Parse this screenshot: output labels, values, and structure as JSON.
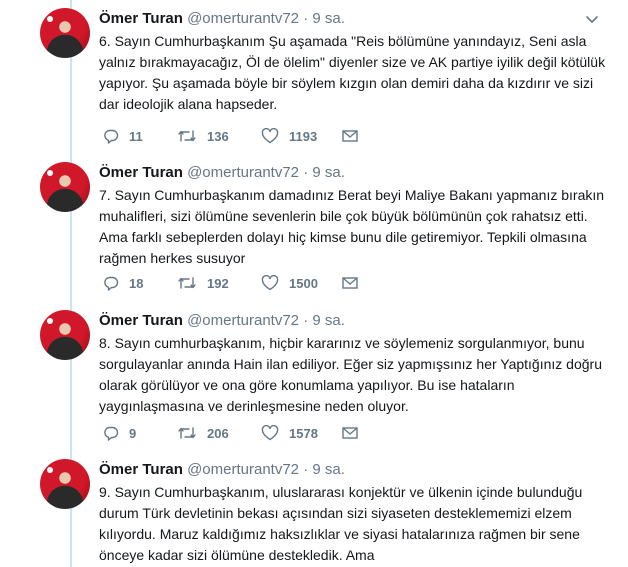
{
  "tweets": [
    {
      "name": "Ömer Turan",
      "handle": "@omerturantv72",
      "dot": "·",
      "time": "9 sa.",
      "text": "6. Sayın Cumhurbaşkanım Şu aşamada \"Reis bölümüne yanındayız, Seni asla yalnız bırakmayacağız, Öl de ölelim\" diyenler size ve AK partiye iyilik değil kötülük yapıyor. Şu aşamada böyle bir söylem kızgın olan demiri daha da kızdırır ve sizi dar ideolojik alana hapseder.",
      "replies": "11",
      "retweets": "136",
      "likes": "1193"
    },
    {
      "name": "Ömer Turan",
      "handle": "@omerturantv72",
      "dot": "·",
      "time": "9 sa.",
      "text": "7. Sayın Cumhurbaşkanım damadınız Berat beyi Maliye Bakanı yapmanız  bırakın muhalifleri, sizi ölümüne sevenlerin bile  çok büyük bölümünün çok rahatsız etti. Ama farklı sebeplerden dolayı hiç kimse bunu dile getiremiyor. Tepkili olmasına rağmen herkes susuyor",
      "replies": "18",
      "retweets": "192",
      "likes": "1500"
    },
    {
      "name": "Ömer Turan",
      "handle": "@omerturantv72",
      "dot": "·",
      "time": "9 sa.",
      "text": "8. Sayın cumhurbaşkanım, hiçbir kararınız ve söylemeniz sorgulanmıyor, bunu sorgulayanlar anında Hain ilan ediliyor. Eğer siz yapmışsınız her Yaptığınız doğru olarak görülüyor ve ona göre konumlama yapılıyor. Bu ise hataların yaygınlaşmasına ve derinleşmesine neden oluyor.",
      "replies": "9",
      "retweets": "206",
      "likes": "1578"
    },
    {
      "name": "Ömer Turan",
      "handle": "@omerturantv72",
      "dot": "·",
      "time": "9 sa.",
      "text": "9. Sayın Cumhurbaşkanım, uluslararası konjektür ve ülkenin içinde bulunduğu durum Türk devletinin bekası açısından sizi siyaseten desteklememizi elzem kılıyordu. Maruz kaldığımız haksızlıklar ve siyasi hatalarınıza rağmen bir sene önceye kadar sizi ölümüne destekledik. Ama"
    }
  ],
  "icons": {
    "reply": "reply-icon",
    "retweet": "retweet-icon",
    "like": "heart-icon",
    "message": "envelope-icon",
    "more": "chevron-down-icon"
  },
  "colors": {
    "thread_line": "#c7e6f5",
    "muted": "#657786",
    "text": "#14171a"
  }
}
